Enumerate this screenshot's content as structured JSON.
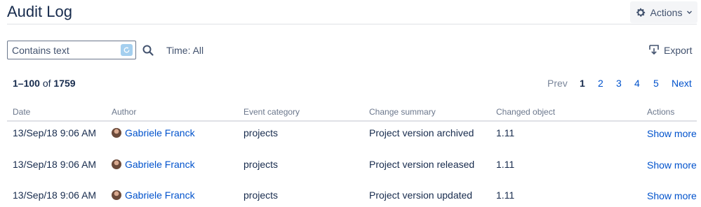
{
  "header": {
    "title": "Audit Log",
    "actions_label": "Actions",
    "actions_icon": "gear-icon"
  },
  "filters": {
    "search_placeholder": "Contains text",
    "search_value": "",
    "time_label": "Time: All",
    "export_label": "Export"
  },
  "results": {
    "range": "1–100",
    "of_word": "of",
    "total": "1759"
  },
  "pagination": {
    "prev": "Prev",
    "current": "1",
    "pages": [
      "2",
      "3",
      "4",
      "5"
    ],
    "next": "Next"
  },
  "table": {
    "columns": [
      "Date",
      "Author",
      "Event category",
      "Change summary",
      "Changed object",
      "Actions"
    ],
    "rows": [
      {
        "date": "13/Sep/18 9:06 AM",
        "author": "Gabriele Franck",
        "category": "projects",
        "summary": "Project version archived",
        "object": "1.11",
        "action": "Show more"
      },
      {
        "date": "13/Sep/18 9:06 AM",
        "author": "Gabriele Franck",
        "category": "projects",
        "summary": "Project version released",
        "object": "1.11",
        "action": "Show more"
      },
      {
        "date": "13/Sep/18 9:06 AM",
        "author": "Gabriele Franck",
        "category": "projects",
        "summary": "Project version updated",
        "object": "1.11",
        "action": "Show more"
      }
    ]
  },
  "colors": {
    "link": "#0052cc",
    "text": "#172b4d",
    "muted": "#6b778c"
  }
}
